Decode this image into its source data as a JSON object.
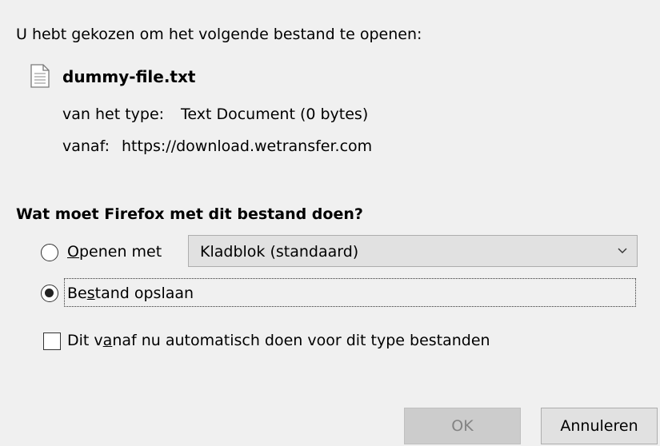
{
  "dialog": {
    "intro": "U hebt gekozen om het volgende bestand te openen:",
    "file_name": "dummy-file.txt",
    "type_label": "van het type:",
    "type_value": "Text Document (0 bytes)",
    "from_label": "vanaf:",
    "from_value": "https://download.wetransfer.com",
    "question": "Wat moet Firefox met dit bestand doen?",
    "open_with": {
      "label_key": "O",
      "label_rest": "penen met",
      "selected": false,
      "app_value": "Kladblok (standaard)"
    },
    "save": {
      "label_pre": "Be",
      "label_key": "s",
      "label_rest": "tand opslaan",
      "selected": true
    },
    "auto": {
      "label_pre": "Dit v",
      "label_key": "a",
      "label_rest": "naf nu automatisch doen voor dit type bestanden",
      "checked": false
    },
    "ok_label": "OK",
    "ok_disabled": true,
    "cancel_label": "Annuleren"
  },
  "icons": {
    "file": "text-file-icon",
    "chevron": "chevron-down-icon"
  },
  "colors": {
    "background": "#f0f0f0",
    "button": "#e1e1e1",
    "button_disabled": "#cccccc",
    "disabled_text": "#838383"
  }
}
